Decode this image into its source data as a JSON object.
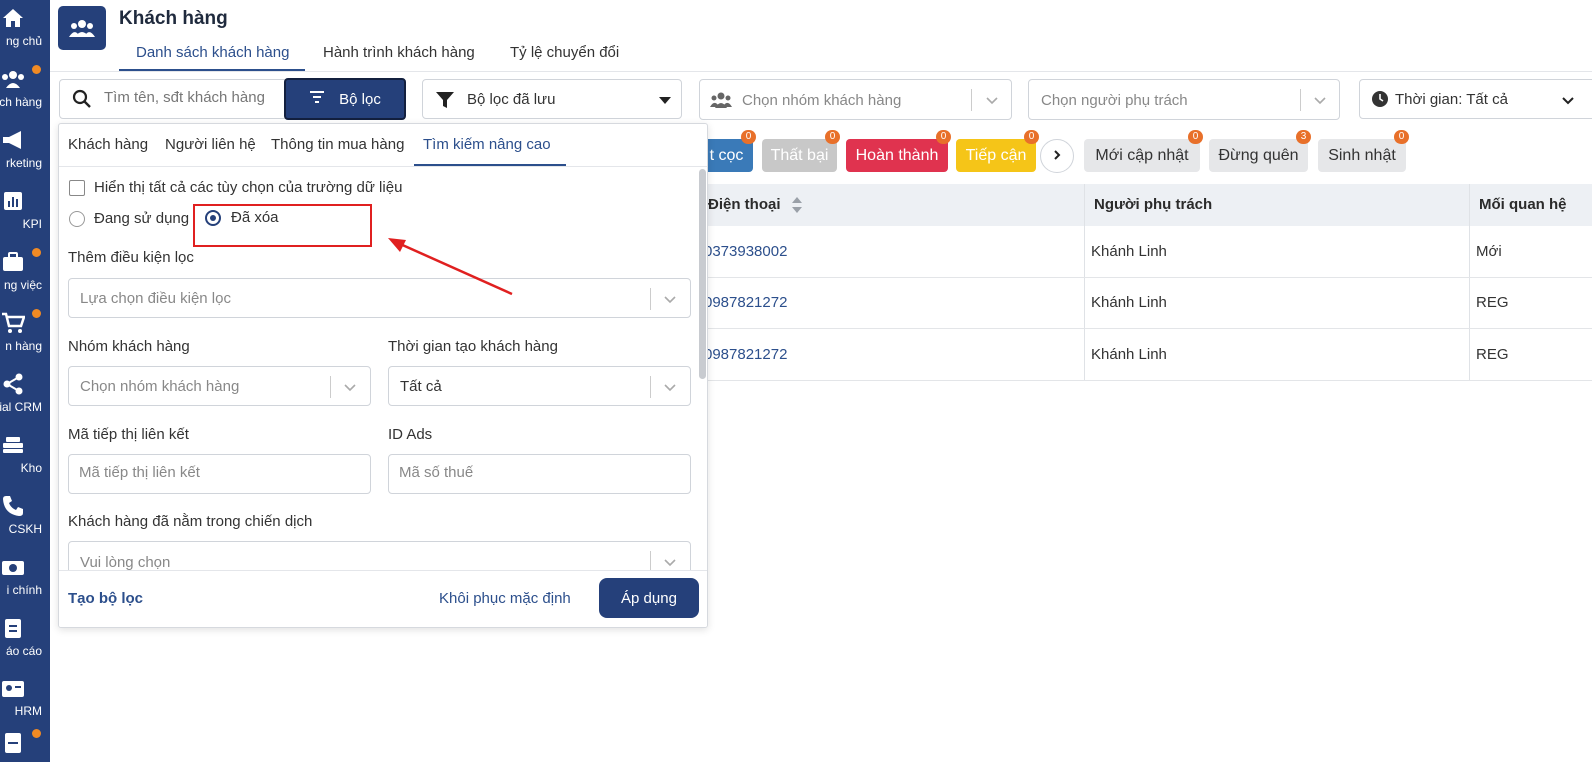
{
  "sidebar": {
    "items": [
      {
        "label": "ng chủ",
        "icon": "home-icon",
        "dot": false
      },
      {
        "label": "ch hàng",
        "icon": "people-icon",
        "dot": true
      },
      {
        "label": "rketing",
        "icon": "megaphone-icon",
        "dot": false
      },
      {
        "label": "KPI",
        "icon": "chart-icon",
        "dot": false
      },
      {
        "label": "ng việc",
        "icon": "briefcase-icon",
        "dot": true
      },
      {
        "label": "n hàng",
        "icon": "cart-icon",
        "dot": true
      },
      {
        "label": "ial CRM",
        "icon": "share-icon",
        "dot": false
      },
      {
        "label": "Kho",
        "icon": "warehouse-icon",
        "dot": false
      },
      {
        "label": "CSKH",
        "icon": "phone-icon",
        "dot": false
      },
      {
        "label": "i chính",
        "icon": "money-icon",
        "dot": false
      },
      {
        "label": "áo cáo",
        "icon": "report-icon",
        "dot": false
      },
      {
        "label": "HRM",
        "icon": "id-card-icon",
        "dot": false
      },
      {
        "label": "",
        "icon": "document-icon",
        "dot": true
      }
    ]
  },
  "header": {
    "title": "Khách hàng",
    "tabs": [
      {
        "label": "Danh sách khách hàng",
        "active": true
      },
      {
        "label": "Hành trình khách hàng",
        "active": false
      },
      {
        "label": "Tỷ lệ chuyển đổi",
        "active": false
      }
    ]
  },
  "toolbar": {
    "search_placeholder": "Tìm tên, sđt khách hàng",
    "filter_button": "Bộ lọc",
    "saved_filter": "Bộ lọc đã lưu",
    "group_placeholder": "Chọn nhóm khách hàng",
    "owner_placeholder": "Chọn người phụ trách",
    "time_filter": "Thời gian: Tất cả"
  },
  "chips": [
    {
      "label": "t cọc",
      "badge": "0",
      "bg": "#3a7ab8",
      "fg": "#ffffff"
    },
    {
      "label": "Thất bại",
      "badge": "0",
      "bg": "#c8c8c8",
      "fg": "#ffffff"
    },
    {
      "label": "Hoàn thành",
      "badge": "0",
      "bg": "#e0334f",
      "fg": "#ffffff"
    },
    {
      "label": "Tiếp cận",
      "badge": "0",
      "bg": "#f5c518",
      "fg": "#ffffff"
    },
    {
      "label": "Mới cập nhật",
      "badge": "0",
      "bg": "#e6e7e9",
      "fg": "#333333"
    },
    {
      "label": "Đừng quên",
      "badge": "3",
      "bg": "#e6e7e9",
      "fg": "#333333"
    },
    {
      "label": "Sinh nhật",
      "badge": "0",
      "bg": "#e6e7e9",
      "fg": "#333333"
    }
  ],
  "table": {
    "columns": [
      "Điện thoại",
      "Người phụ trách",
      "Mối quan hệ"
    ],
    "rows": [
      {
        "phone": "0373938002",
        "owner": "Khánh Linh",
        "relation": "Mới"
      },
      {
        "phone": "0987821272",
        "owner": "Khánh Linh",
        "relation": "REG"
      },
      {
        "phone": "0987821272",
        "owner": "Khánh Linh",
        "relation": "REG"
      }
    ]
  },
  "filter_panel": {
    "tabs": [
      {
        "label": "Khách hàng",
        "active": false
      },
      {
        "label": "Người liên hệ",
        "active": false
      },
      {
        "label": "Thông tin mua hàng",
        "active": false
      },
      {
        "label": "Tìm kiếm nâng cao",
        "active": true
      }
    ],
    "show_all_label": "Hiển thị tất cả các tùy chọn của trường dữ liệu",
    "show_all_checked": false,
    "radio_in_use": "Đang sử dụng",
    "radio_deleted": "Đã xóa",
    "selected_radio": "deleted",
    "add_condition_label": "Thêm điều kiện lọc",
    "add_condition_placeholder": "Lựa chọn điều kiện lọc",
    "group_label": "Nhóm khách hàng",
    "group_placeholder": "Chọn nhóm khách hàng",
    "created_time_label": "Thời gian tạo khách hàng",
    "created_time_value": "Tất cả",
    "affiliate_label": "Mã tiếp thị liên kết",
    "affiliate_placeholder": "Mã tiếp thị liên kết",
    "ads_label": "ID Ads",
    "ads_placeholder": "Mã số thuế",
    "campaign_label": "Khách hàng đã nằm trong chiến dịch",
    "campaign_placeholder": "Vui lòng chọn",
    "create_filter": "Tạo bộ lọc",
    "reset": "Khôi phục mặc định",
    "apply": "Áp dụng"
  },
  "colors": {
    "primary": "#25407a",
    "accent_link": "#2c4f8c",
    "annotation": "#e02020",
    "notification_dot": "#f08a24"
  }
}
